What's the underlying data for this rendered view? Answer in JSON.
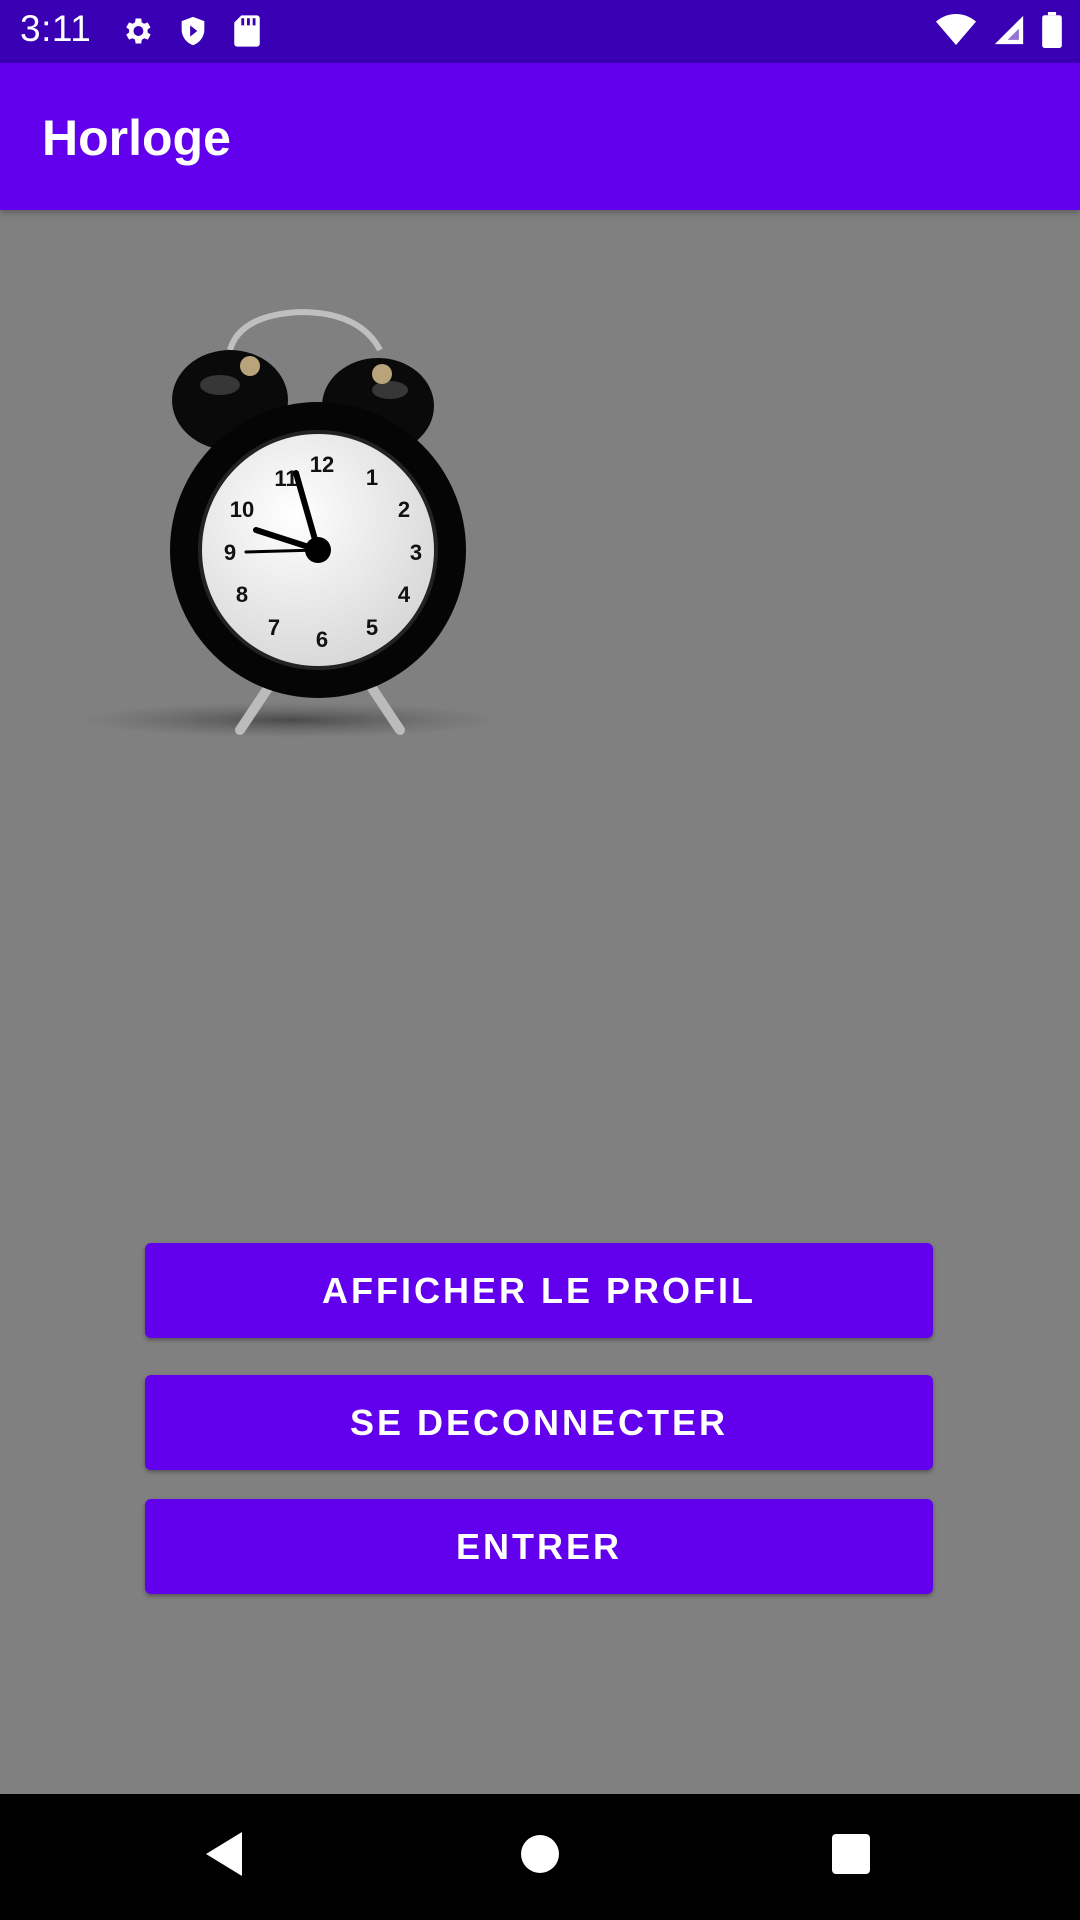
{
  "status_bar": {
    "time": "3:11",
    "left_icons": [
      "settings-icon",
      "shield-play-icon",
      "sd-card-icon"
    ],
    "right_icons": [
      "wifi-icon",
      "signal-icon",
      "battery-icon"
    ]
  },
  "app_bar": {
    "title": "Horloge"
  },
  "image": {
    "subject": "alarm-clock-image"
  },
  "buttons": {
    "profile": "AFFICHER LE PROFIL",
    "logout": "SE DECONNECTER",
    "enter": "ENTRER"
  },
  "nav_bar": {
    "buttons": [
      "back-icon",
      "home-icon",
      "recents-icon"
    ]
  },
  "colors": {
    "primary": "#6200ee",
    "status_bar": "#3a00b3",
    "background": "#808080"
  }
}
